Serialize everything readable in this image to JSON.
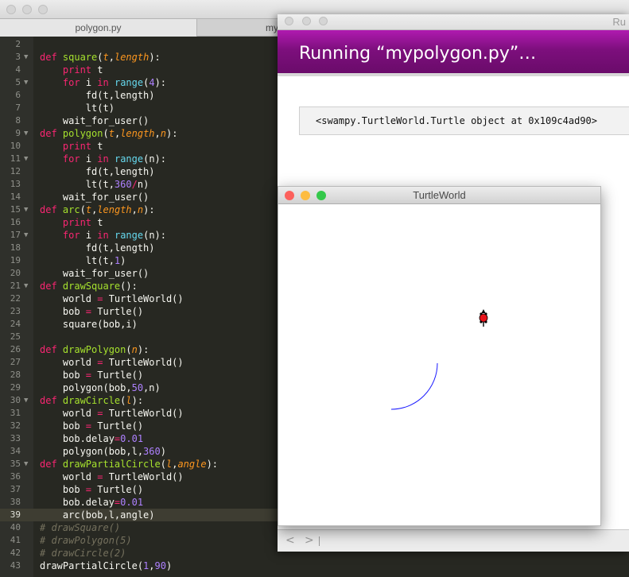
{
  "editor": {
    "tabs": [
      "polygon.py",
      "my"
    ],
    "current_line": 39,
    "lines": [
      {
        "n": 2,
        "fold": false,
        "tokens": []
      },
      {
        "n": 3,
        "fold": true,
        "tokens": [
          [
            "d",
            "def "
          ],
          [
            "f",
            "square"
          ],
          [
            "t",
            "("
          ],
          [
            "p",
            "t"
          ],
          [
            "t",
            ","
          ],
          [
            "p",
            "length"
          ],
          [
            "t",
            "):"
          ]
        ]
      },
      {
        "n": 4,
        "fold": false,
        "tokens": [
          [
            "t",
            "    "
          ],
          [
            "k",
            "print"
          ],
          [
            "t",
            " t"
          ]
        ]
      },
      {
        "n": 5,
        "fold": true,
        "tokens": [
          [
            "t",
            "    "
          ],
          [
            "k",
            "for"
          ],
          [
            "t",
            " i "
          ],
          [
            "k",
            "in"
          ],
          [
            "t",
            " "
          ],
          [
            "b",
            "range"
          ],
          [
            "t",
            "("
          ],
          [
            "n",
            "4"
          ],
          [
            "t",
            "):"
          ]
        ]
      },
      {
        "n": 6,
        "fold": false,
        "tokens": [
          [
            "t",
            "        fd(t,length)"
          ]
        ]
      },
      {
        "n": 7,
        "fold": false,
        "tokens": [
          [
            "t",
            "        lt(t)"
          ]
        ]
      },
      {
        "n": 8,
        "fold": false,
        "tokens": [
          [
            "t",
            "    wait_for_user()"
          ]
        ]
      },
      {
        "n": 9,
        "fold": true,
        "tokens": [
          [
            "d",
            "def "
          ],
          [
            "f",
            "polygon"
          ],
          [
            "t",
            "("
          ],
          [
            "p",
            "t"
          ],
          [
            "t",
            ","
          ],
          [
            "p",
            "length"
          ],
          [
            "t",
            ","
          ],
          [
            "p",
            "n"
          ],
          [
            "t",
            "):"
          ]
        ]
      },
      {
        "n": 10,
        "fold": false,
        "tokens": [
          [
            "t",
            "    "
          ],
          [
            "k",
            "print"
          ],
          [
            "t",
            " t"
          ]
        ]
      },
      {
        "n": 11,
        "fold": true,
        "tokens": [
          [
            "t",
            "    "
          ],
          [
            "k",
            "for"
          ],
          [
            "t",
            " i "
          ],
          [
            "k",
            "in"
          ],
          [
            "t",
            " "
          ],
          [
            "b",
            "range"
          ],
          [
            "t",
            "(n):"
          ]
        ]
      },
      {
        "n": 12,
        "fold": false,
        "tokens": [
          [
            "t",
            "        fd(t,length)"
          ]
        ]
      },
      {
        "n": 13,
        "fold": false,
        "tokens": [
          [
            "t",
            "        lt(t,"
          ],
          [
            "n",
            "360"
          ],
          [
            "k",
            "/"
          ],
          [
            "t",
            "n)"
          ]
        ]
      },
      {
        "n": 14,
        "fold": false,
        "tokens": [
          [
            "t",
            "    wait_for_user()"
          ]
        ]
      },
      {
        "n": 15,
        "fold": true,
        "tokens": [
          [
            "d",
            "def "
          ],
          [
            "f",
            "arc"
          ],
          [
            "t",
            "("
          ],
          [
            "p",
            "t"
          ],
          [
            "t",
            ","
          ],
          [
            "p",
            "length"
          ],
          [
            "t",
            ","
          ],
          [
            "p",
            "n"
          ],
          [
            "t",
            "):"
          ]
        ]
      },
      {
        "n": 16,
        "fold": false,
        "tokens": [
          [
            "t",
            "    "
          ],
          [
            "k",
            "print"
          ],
          [
            "t",
            " t"
          ]
        ]
      },
      {
        "n": 17,
        "fold": true,
        "tokens": [
          [
            "t",
            "    "
          ],
          [
            "k",
            "for"
          ],
          [
            "t",
            " i "
          ],
          [
            "k",
            "in"
          ],
          [
            "t",
            " "
          ],
          [
            "b",
            "range"
          ],
          [
            "t",
            "(n):"
          ]
        ]
      },
      {
        "n": 18,
        "fold": false,
        "tokens": [
          [
            "t",
            "        fd(t,length)"
          ]
        ]
      },
      {
        "n": 19,
        "fold": false,
        "tokens": [
          [
            "t",
            "        lt(t,"
          ],
          [
            "n",
            "1"
          ],
          [
            "t",
            ")"
          ]
        ]
      },
      {
        "n": 20,
        "fold": false,
        "tokens": [
          [
            "t",
            "    wait_for_user()"
          ]
        ]
      },
      {
        "n": 21,
        "fold": true,
        "tokens": [
          [
            "d",
            "def "
          ],
          [
            "f",
            "drawSquare"
          ],
          [
            "t",
            "():"
          ]
        ]
      },
      {
        "n": 22,
        "fold": false,
        "tokens": [
          [
            "t",
            "    world "
          ],
          [
            "k",
            "="
          ],
          [
            "t",
            " TurtleWorld()"
          ]
        ]
      },
      {
        "n": 23,
        "fold": false,
        "tokens": [
          [
            "t",
            "    bob "
          ],
          [
            "k",
            "="
          ],
          [
            "t",
            " Turtle()"
          ]
        ]
      },
      {
        "n": 24,
        "fold": false,
        "tokens": [
          [
            "t",
            "    square(bob,i)"
          ]
        ]
      },
      {
        "n": 25,
        "fold": false,
        "tokens": []
      },
      {
        "n": 26,
        "fold": false,
        "tokens": [
          [
            "d",
            "def "
          ],
          [
            "f",
            "drawPolygon"
          ],
          [
            "t",
            "("
          ],
          [
            "p",
            "n"
          ],
          [
            "t",
            "):"
          ]
        ]
      },
      {
        "n": 27,
        "fold": false,
        "tokens": [
          [
            "t",
            "    world "
          ],
          [
            "k",
            "="
          ],
          [
            "t",
            " TurtleWorld()"
          ]
        ]
      },
      {
        "n": 28,
        "fold": false,
        "tokens": [
          [
            "t",
            "    bob "
          ],
          [
            "k",
            "="
          ],
          [
            "t",
            " Turtle()"
          ]
        ]
      },
      {
        "n": 29,
        "fold": false,
        "tokens": [
          [
            "t",
            "    polygon(bob,"
          ],
          [
            "n",
            "50"
          ],
          [
            "t",
            ",n)"
          ]
        ]
      },
      {
        "n": 30,
        "fold": true,
        "tokens": [
          [
            "d",
            "def "
          ],
          [
            "f",
            "drawCircle"
          ],
          [
            "t",
            "("
          ],
          [
            "p",
            "l"
          ],
          [
            "t",
            "):"
          ]
        ]
      },
      {
        "n": 31,
        "fold": false,
        "tokens": [
          [
            "t",
            "    world "
          ],
          [
            "k",
            "="
          ],
          [
            "t",
            " TurtleWorld()"
          ]
        ]
      },
      {
        "n": 32,
        "fold": false,
        "tokens": [
          [
            "t",
            "    bob "
          ],
          [
            "k",
            "="
          ],
          [
            "t",
            " Turtle()"
          ]
        ]
      },
      {
        "n": 33,
        "fold": false,
        "tokens": [
          [
            "t",
            "    bob.delay"
          ],
          [
            "k",
            "="
          ],
          [
            "n",
            "0.01"
          ]
        ]
      },
      {
        "n": 34,
        "fold": false,
        "tokens": [
          [
            "t",
            "    polygon(bob,l,"
          ],
          [
            "n",
            "360"
          ],
          [
            "t",
            ")"
          ]
        ]
      },
      {
        "n": 35,
        "fold": true,
        "tokens": [
          [
            "d",
            "def "
          ],
          [
            "f",
            "drawPartialCircle"
          ],
          [
            "t",
            "("
          ],
          [
            "p",
            "l"
          ],
          [
            "t",
            ","
          ],
          [
            "p",
            "angle"
          ],
          [
            "t",
            "):"
          ]
        ]
      },
      {
        "n": 36,
        "fold": false,
        "tokens": [
          [
            "t",
            "    world "
          ],
          [
            "k",
            "="
          ],
          [
            "t",
            " TurtleWorld()"
          ]
        ]
      },
      {
        "n": 37,
        "fold": false,
        "tokens": [
          [
            "t",
            "    bob "
          ],
          [
            "k",
            "="
          ],
          [
            "t",
            " Turtle()"
          ]
        ]
      },
      {
        "n": 38,
        "fold": false,
        "tokens": [
          [
            "t",
            "    bob.delay"
          ],
          [
            "k",
            "="
          ],
          [
            "n",
            "0.01"
          ]
        ]
      },
      {
        "n": 39,
        "fold": false,
        "tokens": [
          [
            "t",
            "    arc(bob,l,angle)"
          ]
        ]
      },
      {
        "n": 40,
        "fold": false,
        "tokens": [
          [
            "c",
            "# drawSquare()"
          ]
        ]
      },
      {
        "n": 41,
        "fold": false,
        "tokens": [
          [
            "c",
            "# drawPolygon(5)"
          ]
        ]
      },
      {
        "n": 42,
        "fold": false,
        "tokens": [
          [
            "c",
            "# drawCircle(2)"
          ]
        ]
      },
      {
        "n": 43,
        "fold": false,
        "tokens": [
          [
            "t",
            "drawPartialCircle("
          ],
          [
            "n",
            "1"
          ],
          [
            "t",
            ","
          ],
          [
            "n",
            "90"
          ],
          [
            "t",
            ")"
          ]
        ]
      }
    ]
  },
  "run_window": {
    "title": "Ru",
    "heading": "Running “mypolygon.py”…",
    "output": "<swampy.TurtleWorld.Turtle object at 0x109c4ad90>",
    "nav_back": "<",
    "nav_forward": ">"
  },
  "turtle_window": {
    "title": "TurtleWorld",
    "light_colors": [
      "#fc605b",
      "#fdbc40",
      "#34c84a"
    ],
    "path_color": "#1a1aff",
    "turtle_color": "#e8141b"
  },
  "colors": {
    "editor_bg": "#272822",
    "run_header": "#8a138a"
  }
}
